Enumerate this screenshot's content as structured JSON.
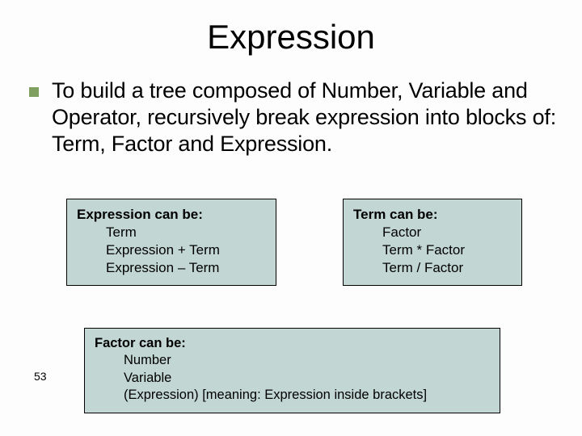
{
  "title": "Expression",
  "bullet": "To build a tree composed of Number, Variable and Operator, recursively break expression into blocks of: Term, Factor and Expression.",
  "boxes": {
    "expression": {
      "heading": "Expression can be:",
      "items": [
        "Term",
        "Expression + Term",
        "Expression – Term"
      ]
    },
    "term": {
      "heading": "Term can be:",
      "items": [
        "Factor",
        "Term * Factor",
        "Term / Factor"
      ]
    },
    "factor": {
      "heading": "Factor can be:",
      "items": [
        "Number",
        "Variable",
        "(Expression)  [meaning: Expression inside brackets]"
      ]
    }
  },
  "page_number": "53"
}
